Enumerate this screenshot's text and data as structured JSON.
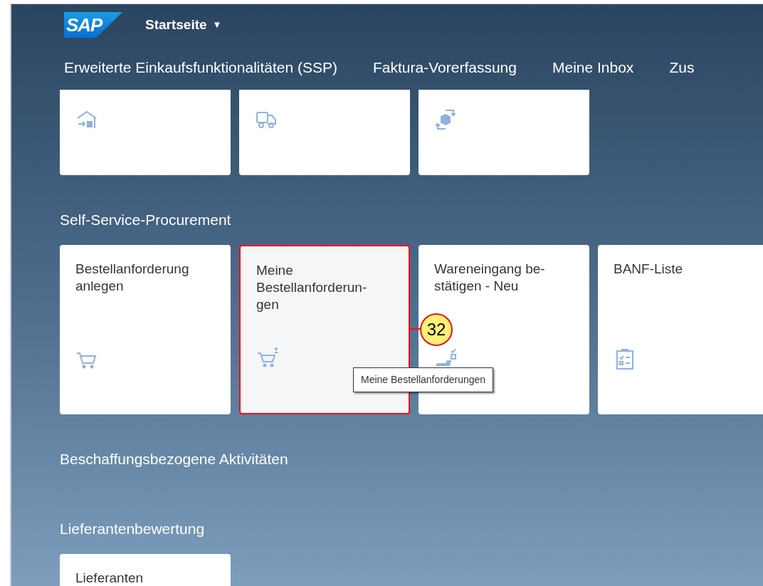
{
  "header": {
    "logo": "SAP",
    "title": "Startseite",
    "caret": "▼"
  },
  "tabs": [
    {
      "label": "Erweiterte Einkaufsfunktionalitäten (SSP)"
    },
    {
      "label": "Faktura-Vorerfassung"
    },
    {
      "label": "Meine Inbox"
    },
    {
      "label": "Zus"
    }
  ],
  "groups": [
    {
      "tiles": [
        {
          "kind": "warehouse",
          "highlighted": false
        },
        {
          "kind": "truck",
          "highlighted": false
        },
        {
          "kind": "box-cycle",
          "highlighted": false
        }
      ]
    },
    {
      "title": "Self-Service-Procurement",
      "tiles": [
        {
          "title": "Bestellanforderung anlegen",
          "kind": "cart",
          "highlighted": false
        },
        {
          "title": "Meine\nBestellanforderun-\ngen",
          "kind": "cart-person",
          "highlighted": true,
          "callout": "32",
          "tooltip": "Meine Bestellanforderungen"
        },
        {
          "title": "Wareneingang be-\nstätigen - Neu",
          "kind": "box-check",
          "highlighted": false
        },
        {
          "title": "BANF-Liste",
          "kind": "clipboard",
          "highlighted": false
        }
      ]
    },
    {
      "title": "Beschaffungsbezogene Aktivitäten"
    },
    {
      "title": "Lieferantenbewertung",
      "tiles": [
        {
          "title": "Lieferanten",
          "highlighted": false
        }
      ]
    }
  ]
}
